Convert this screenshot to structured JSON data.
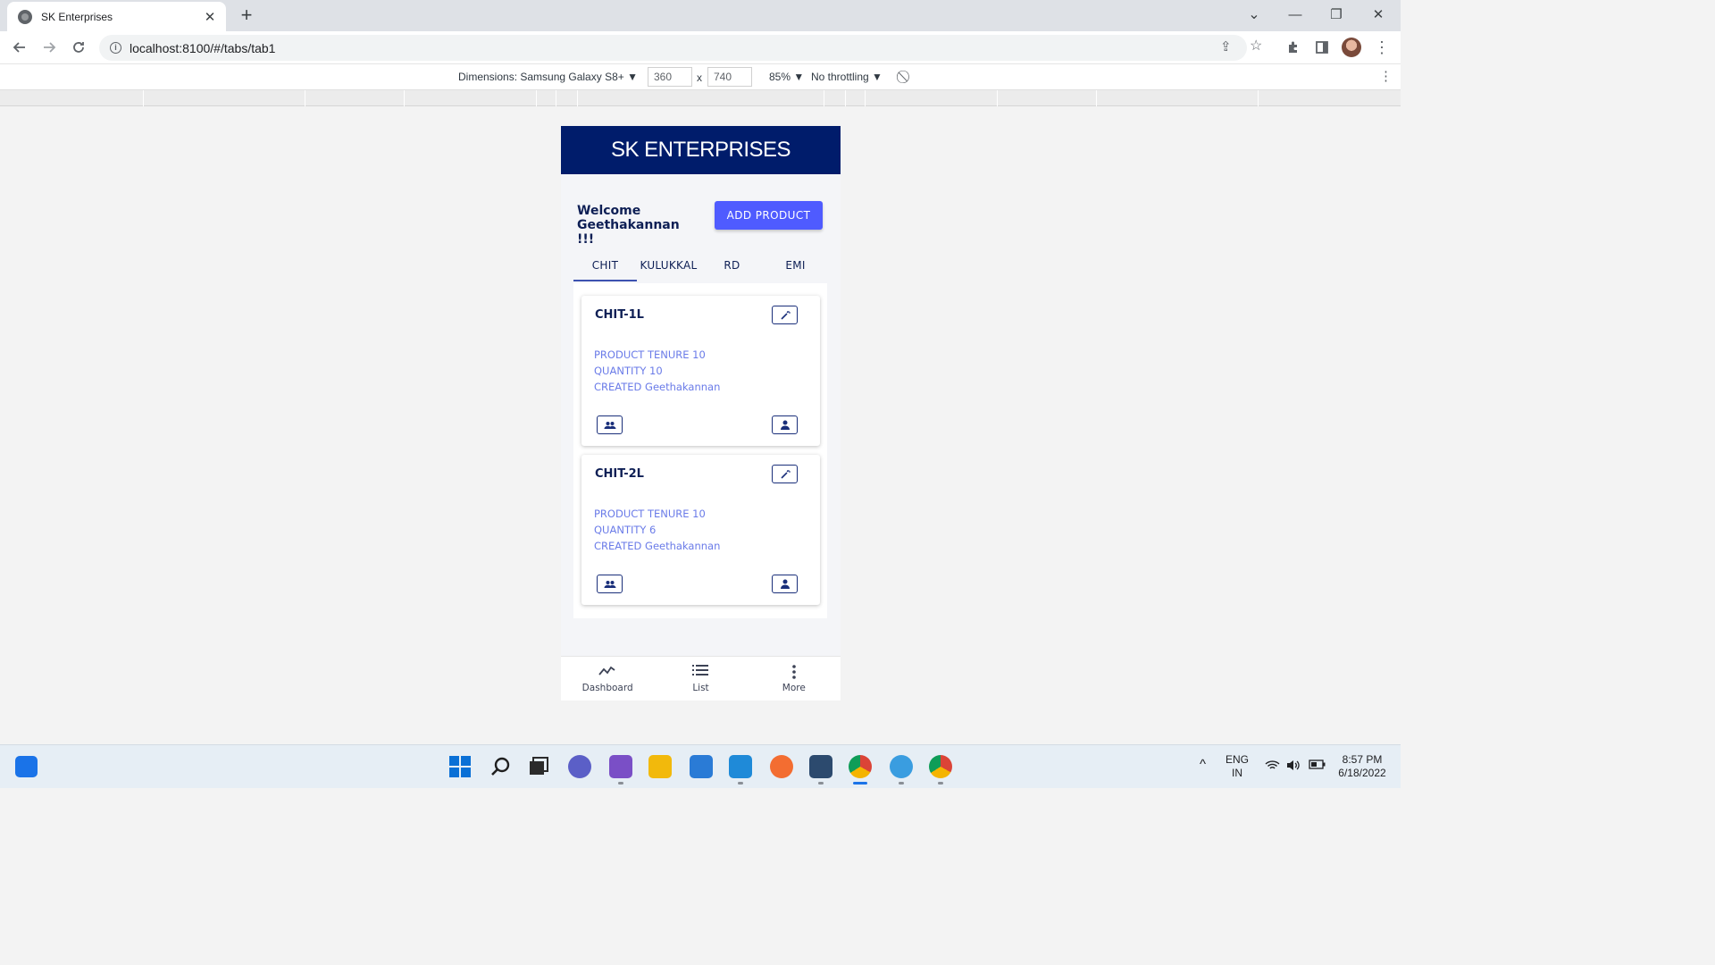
{
  "browser": {
    "tab_title": "SK Enterprises",
    "tab_close": "✕",
    "new_tab": "+",
    "url": "localhost:8100/#/tabs/tab1",
    "controls": {
      "minimize": "—",
      "maximize": "❐",
      "close": "✕",
      "tab_search": "⌄"
    }
  },
  "device_toolbar": {
    "dimensions_label": "Dimensions: Samsung Galaxy S8+ ▼",
    "width": "360",
    "height": "740",
    "times": "x",
    "zoom": "85% ▼",
    "throttling": "No throttling ▼"
  },
  "app": {
    "brand": "SK ENTERPRISES",
    "welcome": "Welcome Geethakannan !!!",
    "add_button": "ADD PRODUCT",
    "segments": [
      {
        "label": "CHIT",
        "active": true
      },
      {
        "label": "KULUKKAL",
        "active": false
      },
      {
        "label": "RD",
        "active": false
      },
      {
        "label": "EMI",
        "active": false
      }
    ],
    "products": [
      {
        "title": "CHIT-1L",
        "tenure": "PRODUCT TENURE 10",
        "quantity": "QUANTITY 10",
        "created": "CREATED Geethakannan"
      },
      {
        "title": "CHIT-2L",
        "tenure": "PRODUCT TENURE 10",
        "quantity": "QUANTITY 6",
        "created": "CREATED Geethakannan"
      }
    ],
    "tabbar": [
      {
        "label": "Dashboard",
        "icon": "trending-icon"
      },
      {
        "label": "List",
        "icon": "list-icon"
      },
      {
        "label": "More",
        "icon": "more-vertical-icon"
      }
    ]
  },
  "taskbar": {
    "language": "ENG",
    "region": "IN",
    "time": "8:57 PM",
    "date": "6/18/2022",
    "apps": [
      "start",
      "search",
      "task-view",
      "chat",
      "visual-studio",
      "file-explorer",
      "notepad",
      "vscode",
      "postman",
      "ssms",
      "chrome",
      "paint",
      "chrome-canary"
    ]
  },
  "colors": {
    "header": "#001c6b",
    "accent_button": "#4f5bff",
    "card_text": "#6a7be8",
    "title_text": "#0e1f55"
  }
}
